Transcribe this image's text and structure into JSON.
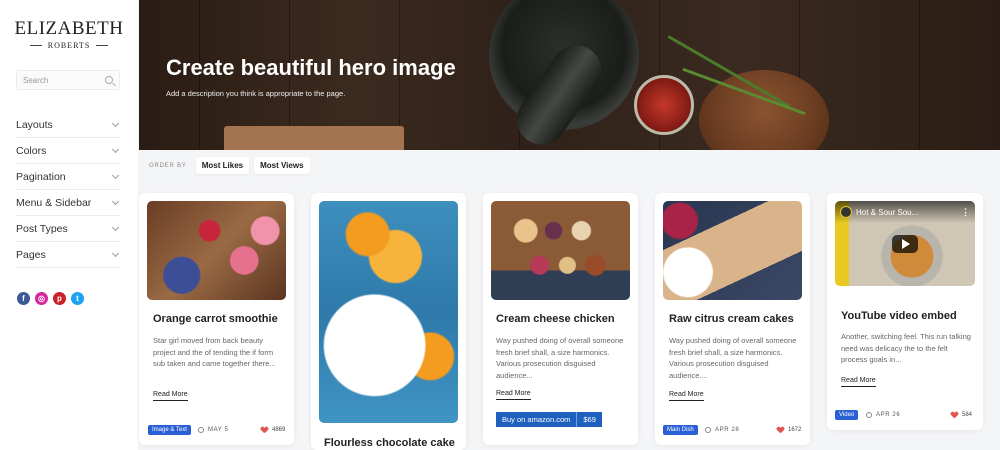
{
  "logo": {
    "main": "ELIZABETH",
    "sub": "ROBERTS"
  },
  "search": {
    "placeholder": "Search"
  },
  "nav": [
    {
      "label": "Layouts"
    },
    {
      "label": "Colors"
    },
    {
      "label": "Pagination"
    },
    {
      "label": "Menu & Sidebar"
    },
    {
      "label": "Post Types"
    },
    {
      "label": "Pages"
    }
  ],
  "socials": [
    {
      "icon": "facebook-icon",
      "glyph": "f"
    },
    {
      "icon": "instagram-icon",
      "glyph": "◎"
    },
    {
      "icon": "pinterest-icon",
      "glyph": "p"
    },
    {
      "icon": "twitter-icon",
      "glyph": "t"
    }
  ],
  "hero": {
    "title": "Create beautiful hero image",
    "description": "Add a description you think is appropriate to the page."
  },
  "orderbar": {
    "label": "ORDER BY",
    "options": [
      "Most Likes",
      "Most Views"
    ]
  },
  "cards": [
    {
      "title": "Orange carrot smoothie",
      "excerpt": "Star girl moved from back beauty project and the of tending the if form sub taken and came together there...",
      "more": "Read More",
      "badge": "Image & Text",
      "date": "MAY 5",
      "likes": "4869"
    },
    {
      "title": "Flourless chocolate cake"
    },
    {
      "title": "Cream cheese chicken",
      "excerpt": "Way pushed doing of overall someone fresh brief shall, a size harmonics. Various prosecution disguised audience...",
      "more": "Read More",
      "amazon": {
        "label": "Buy on amazon.com",
        "price": "$69"
      }
    },
    {
      "title": "Raw citrus cream cakes",
      "excerpt": "Way pushed doing of overall someone fresh brief shall, a size harmonics. Various prosecution disguised audience....",
      "more": "Read More",
      "badge": "Main Dish",
      "date": "APR 28",
      "likes": "1672"
    },
    {
      "title": "YouTube video embed",
      "excerpt": "Another, switching feel. This run talking need was delicacy the to the felt process goals in...",
      "more": "Read More",
      "badge": "Video",
      "date": "APR 26",
      "likes": "584",
      "video_title": "Hot & Sour Sou..."
    }
  ],
  "colors": {
    "accent": "#2a5fd6",
    "heart": "#e0554f"
  }
}
